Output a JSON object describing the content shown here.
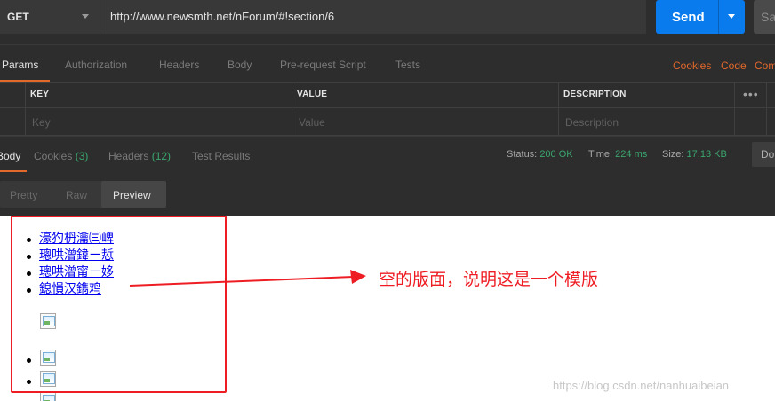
{
  "request": {
    "method": "GET",
    "url": "http://www.newsmth.net/nForum/#!section/6",
    "send_label": "Send",
    "save_label": "Sa"
  },
  "request_tabs": [
    {
      "label": "Params",
      "active": true
    },
    {
      "label": "Authorization"
    },
    {
      "label": "Headers"
    },
    {
      "label": "Body"
    },
    {
      "label": "Pre-request Script"
    },
    {
      "label": "Tests"
    }
  ],
  "request_links": {
    "cookies": "Cookies",
    "code": "Code",
    "comments": "Com"
  },
  "params_table": {
    "headers": {
      "key": "KEY",
      "value": "VALUE",
      "description": "DESCRIPTION"
    },
    "placeholders": {
      "key": "Key",
      "value": "Value",
      "description": "Description"
    },
    "more": "•••"
  },
  "response_tabs": {
    "body": "Body",
    "cookies": "Cookies",
    "cookies_count": "(3)",
    "headers": "Headers",
    "headers_count": "(12)",
    "test_results": "Test Results"
  },
  "response_status": {
    "status_label": "Status:",
    "status_value": "200 OK",
    "time_label": "Time:",
    "time_value": "224 ms",
    "size_label": "Size:",
    "size_value": "17.13 KB",
    "download_label": "Do"
  },
  "view_modes": {
    "pretty": "Pretty",
    "raw": "Raw",
    "preview": "Preview",
    "selected": "Preview"
  },
  "preview": {
    "links": [
      "濠犳枬瀹㈢崥",
      "璁哄潧鍏ㄧ悊",
      "璁哄潧甯ㄧ姼",
      "鎴愪汉鐫鸡"
    ],
    "annotation": "空的版面，说明这是一个模版",
    "watermark": "https://blog.csdn.net/nanhuaibeian"
  },
  "colors": {
    "accent": "#e3682b",
    "send": "#097bed",
    "status_ok": "#3ba56e",
    "annotation_red": "#ee1d23",
    "link": "#0000ee"
  }
}
